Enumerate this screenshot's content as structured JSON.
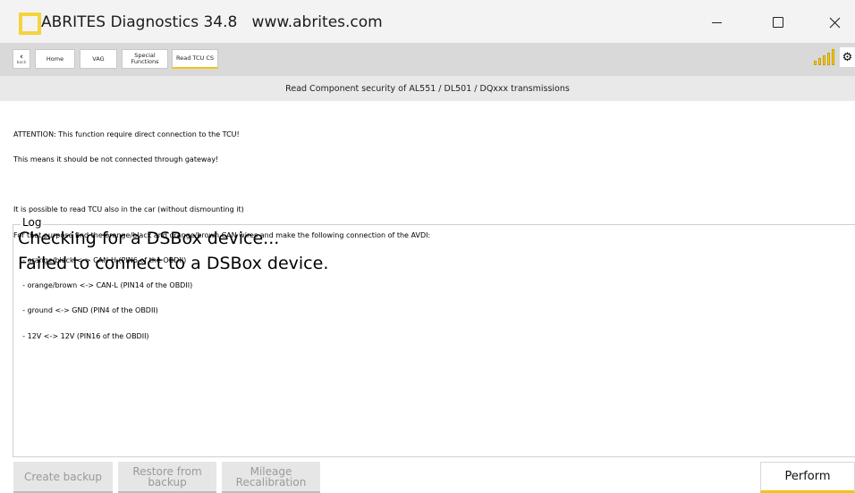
{
  "window": {
    "title": "ABRITES Diagnostics 34.8   www.abrites.com"
  },
  "toolbar": {
    "back_label": "back",
    "breadcrumbs": [
      "Home",
      "VAG",
      "Special Functions",
      "Read TCU CS"
    ]
  },
  "header": {
    "title": "Read Component security of AL551 / DL501 / DQxxx transmissions"
  },
  "info": {
    "lines": [
      "ATTENTION: This function require direct connection to the TCU!",
      "This means it should be not connected through gateway!",
      "",
      "It is possible to read TCU also in the car (without dismounting it)",
      "For that purpose find the orange/black and orange/brown CAN wires and make the following connection of the AVDI:",
      "    - orange/black <-> CAN-H (PIN6 of the OBDII)",
      "    - orange/brown <-> CAN-L (PIN14 of the OBDII)",
      "    - ground <-> GND (PIN4 of the OBDII)",
      "    - 12V <-> 12V (PIN16 of the OBDII)"
    ]
  },
  "log": {
    "legend": "Log",
    "lines": [
      "Checking for a DSBox device...",
      "Failed to connect to a DSBox device."
    ]
  },
  "buttons": {
    "create_backup": "Create backup",
    "restore_from_backup_l1": "Restore from",
    "restore_from_backup_l2": "backup",
    "mileage_l1": "Mileage",
    "mileage_l2": "Recalibration",
    "perform": "Perform"
  },
  "colors": {
    "accent": "#f0c419",
    "toolbar_bg": "#d9d9d9",
    "header_bg": "#e9e9e9"
  },
  "icons": [
    "app-logo-icon",
    "back-chevron-icon",
    "signal-strength-icon",
    "gear-icon",
    "minimize-icon",
    "maximize-icon",
    "close-icon"
  ]
}
